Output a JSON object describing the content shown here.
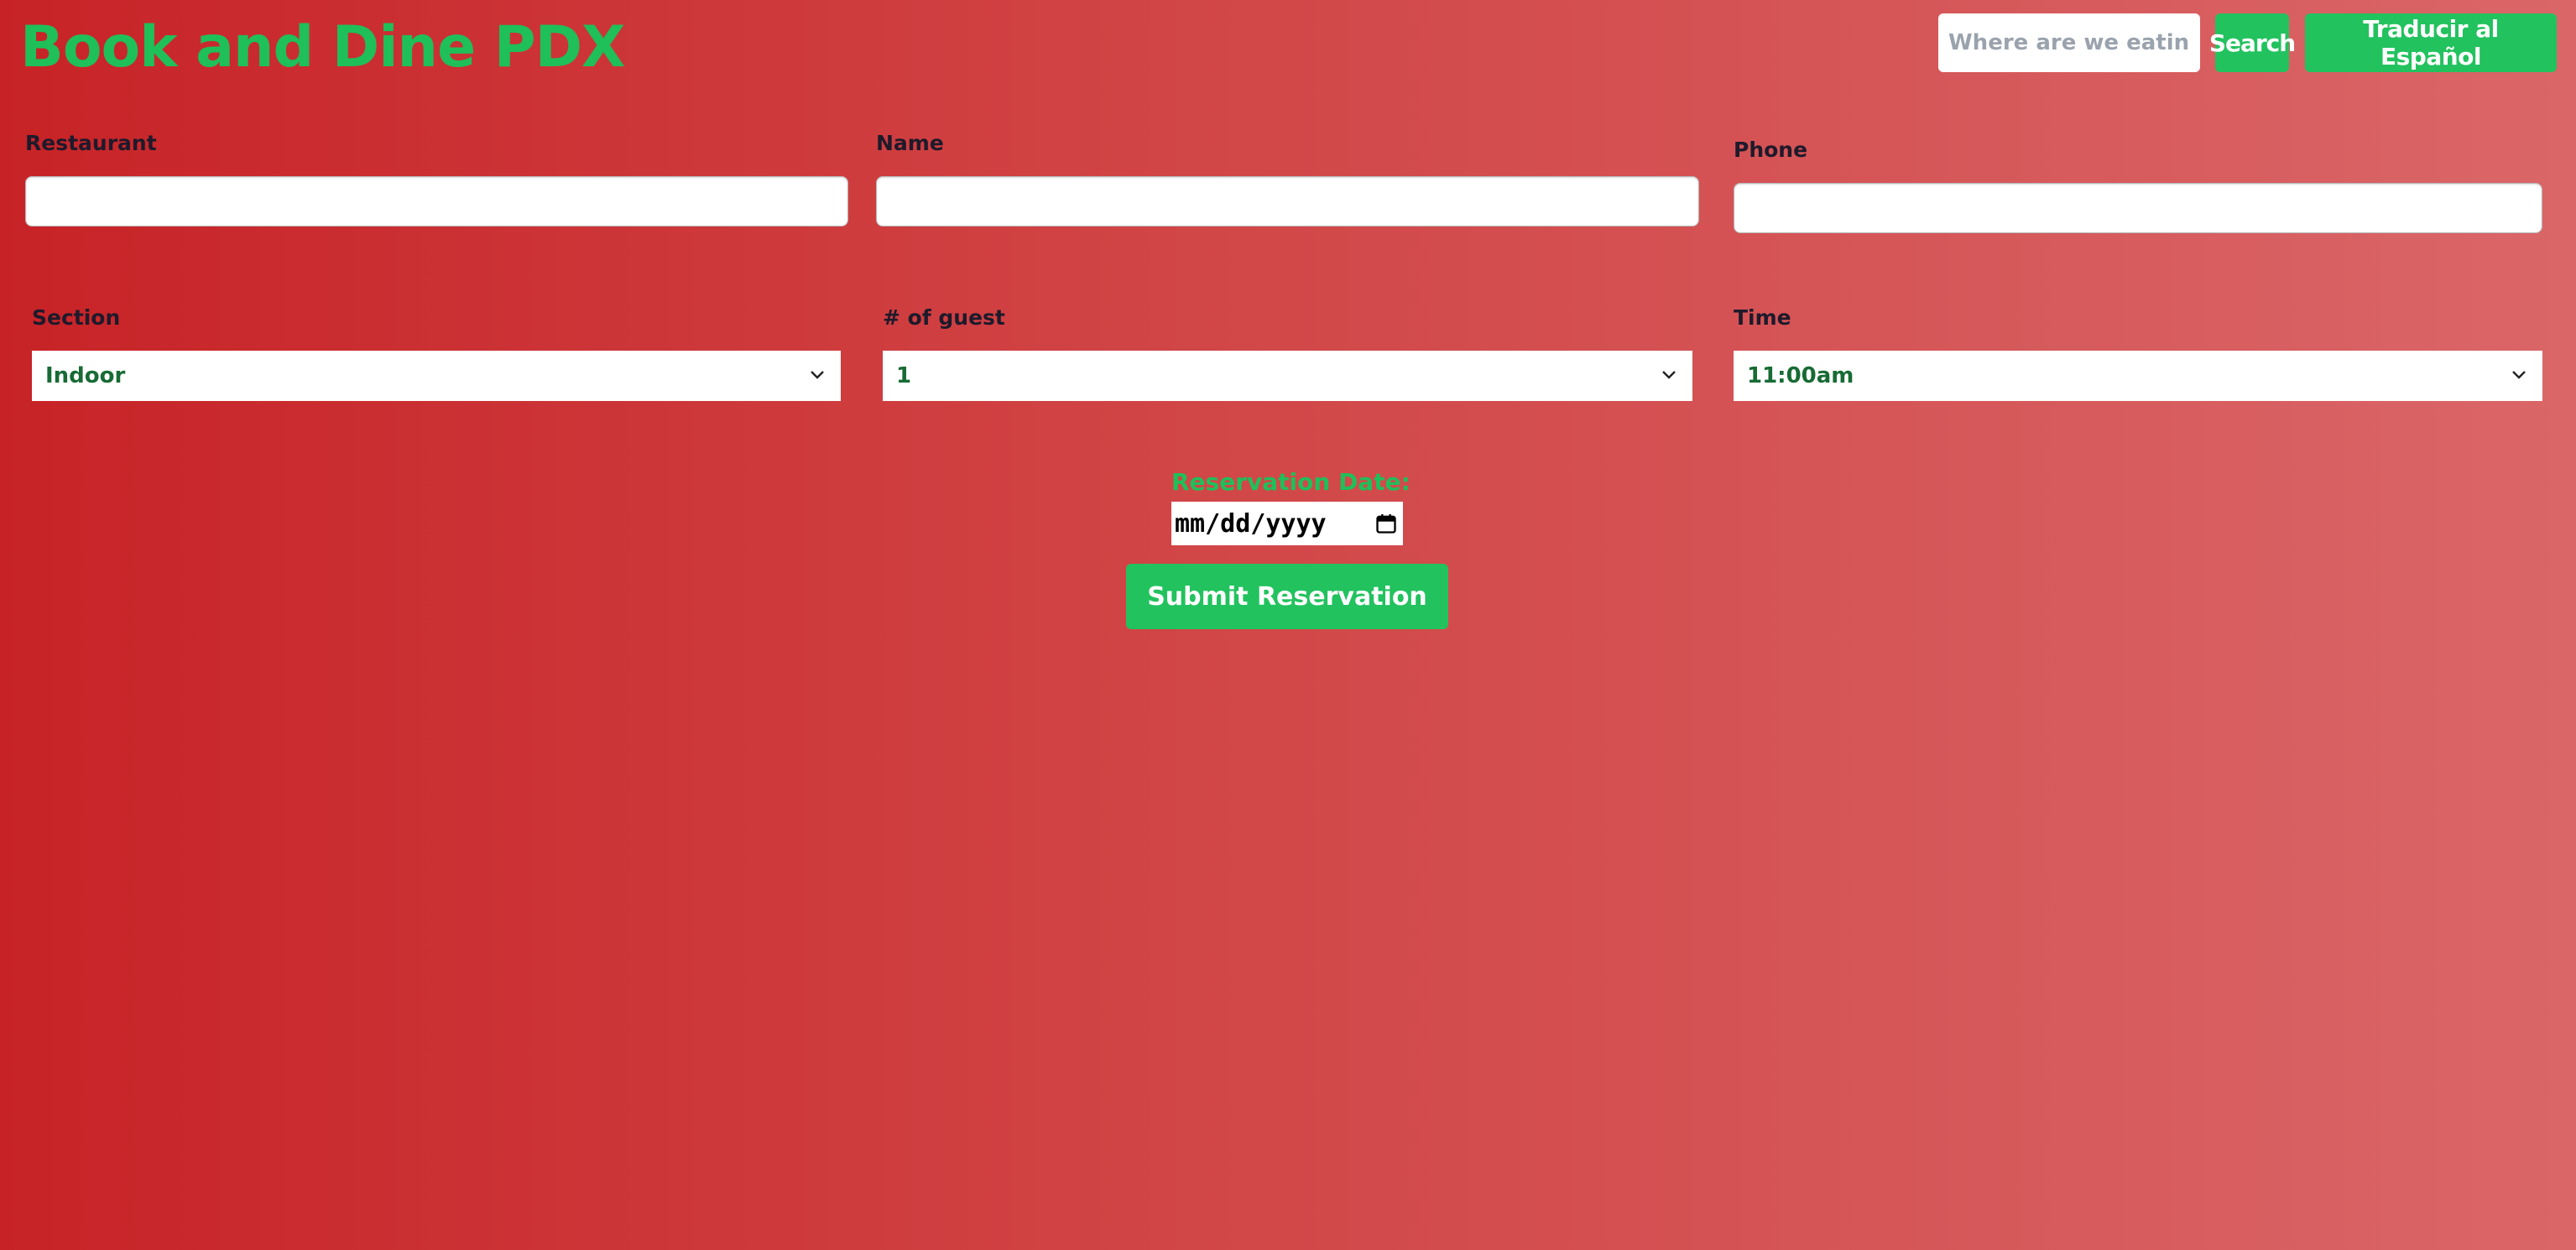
{
  "header": {
    "title": "Book and Dine PDX",
    "search": {
      "placeholder": "Where are we eating?",
      "value": ""
    },
    "search_button": "Search",
    "translate_button": "Traducir al Español"
  },
  "form": {
    "restaurant": {
      "label": "Restaurant",
      "value": ""
    },
    "name": {
      "label": "Name",
      "value": ""
    },
    "phone": {
      "label": "Phone",
      "value": ""
    },
    "section": {
      "label": "Section",
      "selected": "Indoor"
    },
    "guests": {
      "label": "# of guest",
      "selected": "1"
    },
    "time": {
      "label": "Time",
      "selected": "11:00am"
    },
    "date": {
      "label": "Reservation Date:",
      "placeholder": "mm/dd/yyyy"
    },
    "submit": "Submit Reservation"
  },
  "icons": {
    "select_chevron": "chevron-down-icon",
    "date_picker": "calendar-icon"
  },
  "colors": {
    "accent_green": "#22c25e",
    "title_green": "#1fbf5a",
    "select_text": "#176b34",
    "background_start": "#c72327",
    "background_end": "#da6668"
  }
}
